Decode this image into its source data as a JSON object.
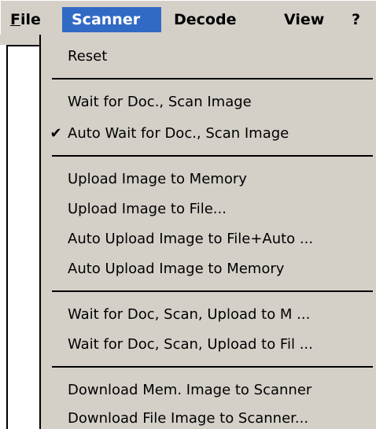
{
  "menubar": {
    "file": "File",
    "scanner": "Scanner",
    "decode": "Decode",
    "view": "View",
    "help": "?"
  },
  "dropdown": {
    "reset": "Reset",
    "wait_scan": "Wait for Doc., Scan Image",
    "auto_wait_scan": "Auto Wait for Doc., Scan Image",
    "auto_wait_scan_checked": true,
    "check_glyph": "✔",
    "upload_memory": "Upload Image to Memory",
    "upload_file": "Upload Image to File...",
    "auto_upload_file": "Auto Upload Image to File+Auto ...",
    "auto_upload_memory": "Auto Upload Image to Memory",
    "wait_scan_upload_mem": "Wait for Doc, Scan, Upload to M ...",
    "wait_scan_upload_file": "Wait for Doc, Scan, Upload to Fil ...",
    "download_mem": "Download Mem. Image to Scanner",
    "download_file": "Download File Image to Scanner..."
  },
  "colors": {
    "menu_bg": "#d4d0c8",
    "highlight_bg": "#316ac5",
    "highlight_fg": "#ffffff",
    "text": "#000000"
  }
}
